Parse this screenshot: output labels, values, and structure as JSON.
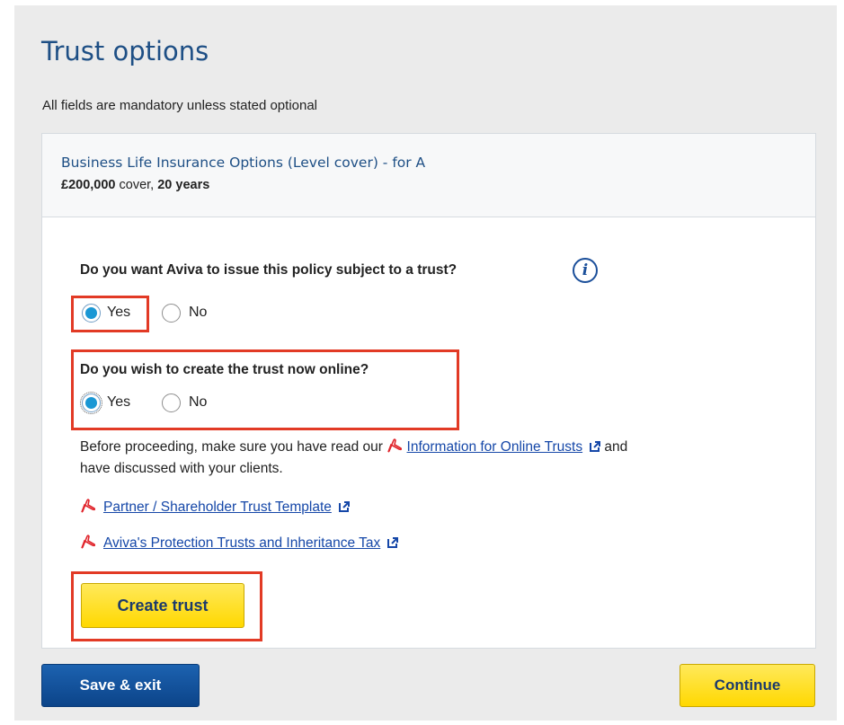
{
  "page": {
    "title": "Trust options",
    "subtitle": "All fields are mandatory unless stated optional"
  },
  "product": {
    "name": "Business Life Insurance Options (Level cover) - for A",
    "cover_amount": "£200,000",
    "cover_word": " cover, ",
    "term": "20 years"
  },
  "question1": {
    "label": "Do you want Aviva to issue this policy subject to a trust?",
    "options": [
      "Yes",
      "No"
    ],
    "selected": "Yes",
    "info_icon": "info-icon"
  },
  "question2": {
    "label": "Do you wish to create the trust now online?",
    "options": [
      "Yes",
      "No"
    ],
    "selected": "Yes"
  },
  "notice": {
    "before": "Before proceeding, make sure you have read our",
    "link": "Information for Online Trusts",
    "after_1": "and",
    "after_2": "have discussed with your clients."
  },
  "links": [
    {
      "label": "Partner / Shareholder Trust Template",
      "icon": "pdf-icon"
    },
    {
      "label": "Aviva's Protection Trusts and Inheritance Tax",
      "icon": "pdf-icon"
    }
  ],
  "buttons": {
    "create_trust": "Create trust",
    "save_exit": "Save & exit",
    "continue": "Continue"
  },
  "colors": {
    "heading": "#1e4f85",
    "link": "#1547a8",
    "radio_selected": "#1a97d4",
    "highlight": "#e23a25",
    "primary_button": "#ffd800",
    "secondary_button": "#0c4489"
  }
}
